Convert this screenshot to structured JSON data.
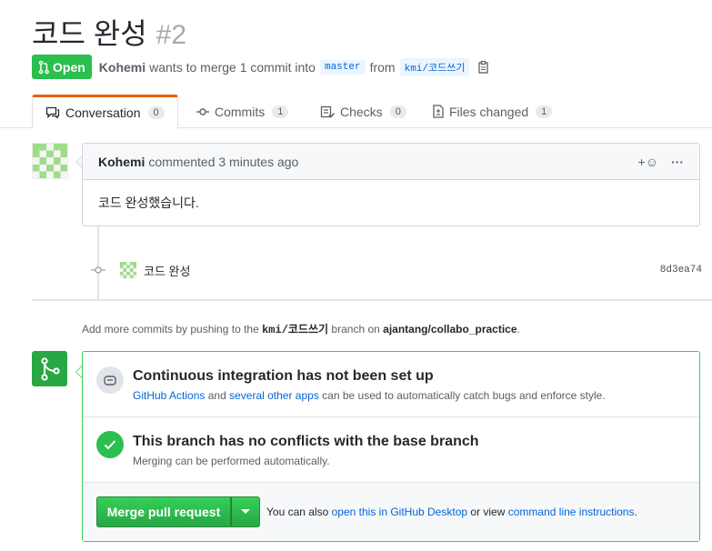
{
  "header": {
    "title": "코드 완성",
    "number": "#2",
    "state": "Open",
    "author": "Kohemi",
    "merge_text": "wants to merge 1 commit into",
    "base_branch": "master",
    "from_text": "from",
    "head_branch": "kmi/코드쓰기"
  },
  "tabs": [
    {
      "label": "Conversation",
      "count": "0"
    },
    {
      "label": "Commits",
      "count": "1"
    },
    {
      "label": "Checks",
      "count": "0"
    },
    {
      "label": "Files changed",
      "count": "1"
    }
  ],
  "comment": {
    "author": "Kohemi",
    "meta": "commented 3 minutes ago",
    "body": "코드 완성했습니다.",
    "reaction_label": "+☺",
    "more_label": "···"
  },
  "commit": {
    "message": "코드 완성",
    "sha": "8d3ea74"
  },
  "add_more": {
    "prefix": "Add more commits by pushing to the",
    "branch": "kmi/코드쓰기",
    "middle": "branch on",
    "repo": "ajantang/collabo_practice",
    "suffix": "."
  },
  "merge": {
    "ci_title": "Continuous integration has not been set up",
    "ci_link1": "GitHub Actions",
    "ci_and": "and",
    "ci_link2": "several other apps",
    "ci_rest": "can be used to automatically catch bugs and enforce style.",
    "conf_title": "This branch has no conflicts with the base branch",
    "conf_desc": "Merging can be performed automatically.",
    "button_label": "Merge pull request",
    "alt_prefix": "You can also",
    "alt_link1": "open this in GitHub Desktop",
    "alt_or": "or view",
    "alt_link2": "command line instructions",
    "alt_suffix": "."
  },
  "colors": {
    "green": "#2cbe4e",
    "link": "#0366d6",
    "tab_accent": "#e36209"
  }
}
